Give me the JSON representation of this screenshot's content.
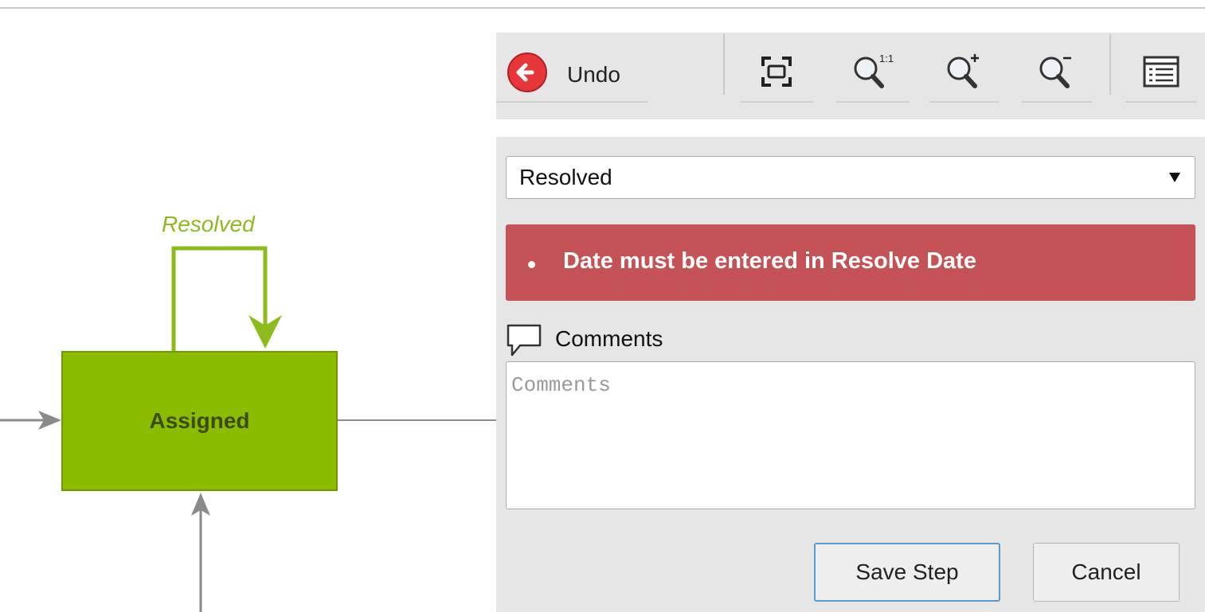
{
  "canvas": {
    "state_name": "Assigned",
    "state_color": "#8bbc00",
    "transition_label": "Resolved",
    "transition_color": "#8dbb1c"
  },
  "toolbar": {
    "undo_label": "Undo",
    "icons": [
      "undo-icon",
      "fit-to-screen-icon",
      "zoom-actual-size-icon",
      "zoom-in-icon",
      "zoom-out-icon",
      "list-view-icon"
    ]
  },
  "panel": {
    "select_value": "Resolved",
    "error_message": "Date must be entered in Resolve Date",
    "error_color": "#c45256",
    "comments_label": "Comments",
    "comments_placeholder": "Comments",
    "save_label": "Save Step",
    "cancel_label": "Cancel"
  }
}
